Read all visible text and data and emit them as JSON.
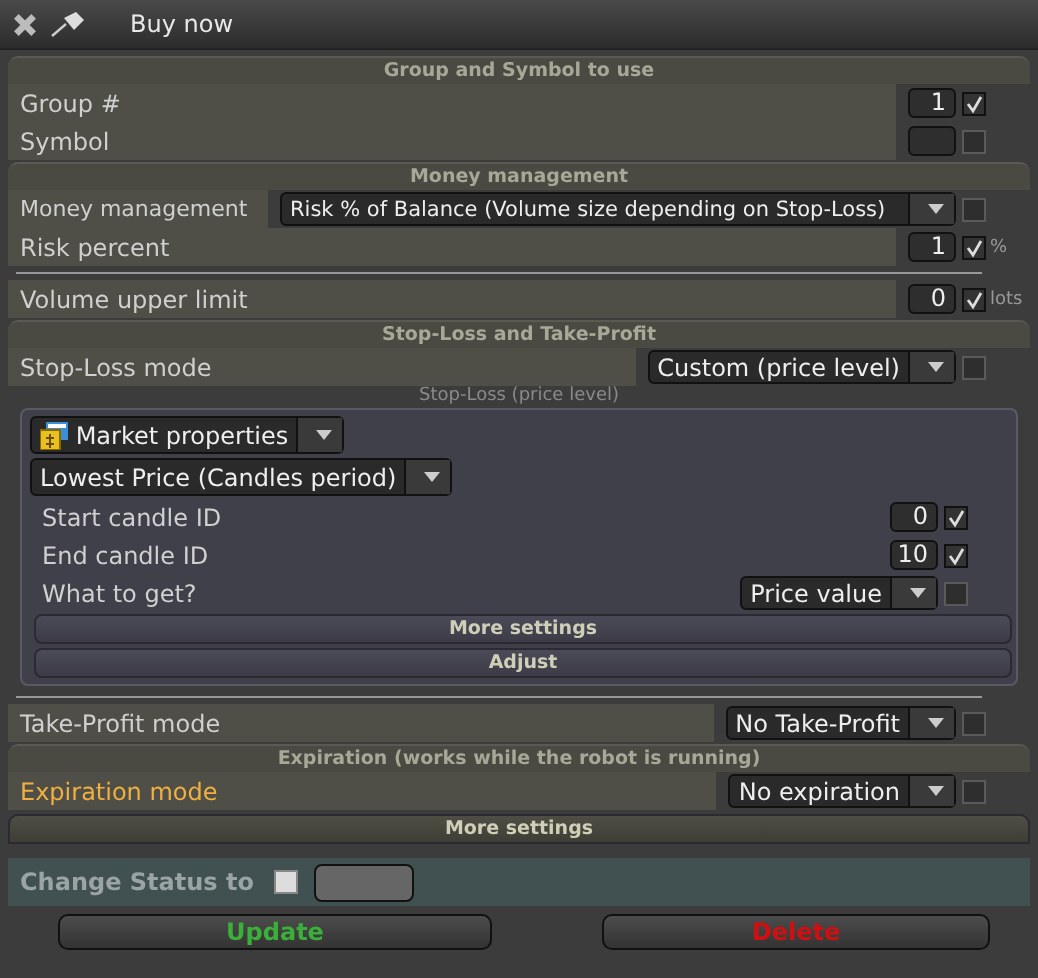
{
  "window": {
    "title": "Buy now"
  },
  "items": [
    {
      "kind": "header",
      "title": "Group and Symbol to use"
    },
    {
      "kind": "field",
      "label": "Group #",
      "value": "1",
      "checked": true,
      "highlighted": false
    },
    {
      "kind": "field",
      "label": "Symbol",
      "checked": false,
      "highlighted": false
    },
    {
      "kind": "header",
      "title": "Money management"
    },
    {
      "kind": "select",
      "label": "Money management",
      "value": "Risk % of Balance (Volume size depending on Stop-Loss)",
      "checked": false,
      "highlighted": false
    },
    {
      "kind": "field",
      "label": "Risk percent",
      "value": "1",
      "checked": true,
      "unit": "%",
      "highlighted": false
    },
    {
      "kind": "divider"
    },
    {
      "kind": "field",
      "label": "Volume upper limit",
      "value": "0",
      "checked": true,
      "unit": "lots",
      "highlighted": false
    },
    {
      "kind": "header",
      "title": "Stop-Loss and Take-Profit"
    },
    {
      "kind": "select",
      "label": "Stop-Loss mode",
      "value": "Custom (price level)",
      "checked": false,
      "highlighted": false
    },
    {
      "kind": "panel",
      "caption": "Stop-Loss (price level)",
      "items": [
        {
          "kind": "source",
          "value": "Market properties"
        },
        {
          "kind": "plain-select",
          "value": "Lowest Price (Candles period)"
        },
        {
          "kind": "field",
          "label": "Start candle ID",
          "value": "0",
          "checked": true
        },
        {
          "kind": "field",
          "label": "End candle ID",
          "value": "10",
          "checked": true
        },
        {
          "kind": "select",
          "label": "What to get?",
          "value": "Price value",
          "checked": false
        },
        {
          "kind": "bar",
          "label": "More settings"
        },
        {
          "kind": "bar",
          "label": "Adjust"
        }
      ]
    },
    {
      "kind": "divider"
    },
    {
      "kind": "select",
      "label": "Take-Profit mode",
      "value": "No Take-Profit",
      "checked": false,
      "highlighted": false
    },
    {
      "kind": "header",
      "title": "Expiration (works while the robot is running)"
    },
    {
      "kind": "select",
      "label": "Expiration mode",
      "value": "No expiration",
      "checked": false,
      "highlighted": true
    },
    {
      "kind": "bar",
      "label": "More settings"
    },
    {
      "kind": "status",
      "label": "Change Status to",
      "checked": false
    }
  ],
  "buttons": [
    {
      "label": "Update",
      "kind": "confirm"
    },
    {
      "label": "Delete",
      "kind": "danger"
    }
  ]
}
